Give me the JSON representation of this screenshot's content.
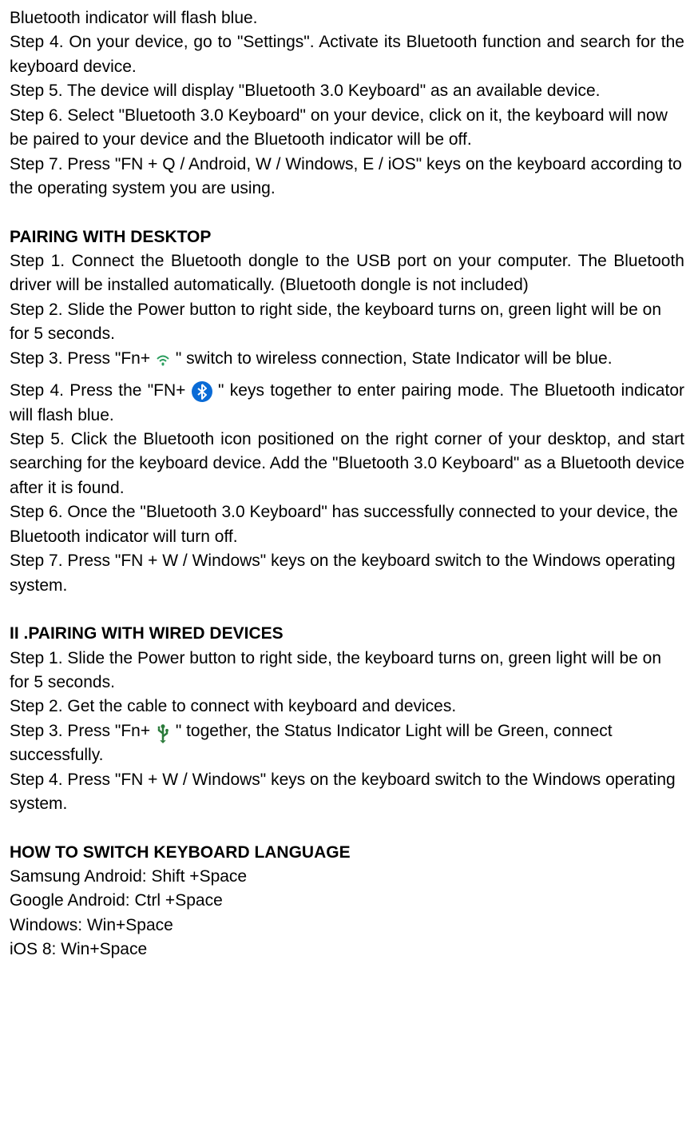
{
  "section1": {
    "line1": "Bluetooth indicator will flash blue.",
    "step4": "Step 4. On your device, go to \"Settings\". Activate its Bluetooth function and search for the keyboard device.",
    "step5": "Step 5. The device will display \"Bluetooth 3.0 Keyboard\" as an available device.",
    "step6": "Step 6. Select \"Bluetooth 3.0 Keyboard\" on your device, click on it, the keyboard will now be paired to your device and the Bluetooth indicator will be off.",
    "step7": "Step 7. Press \"FN + Q / Android, W / Windows, E / iOS\" keys on the keyboard according to the operating system you are using."
  },
  "section2": {
    "heading": "PAIRING WITH DESKTOP",
    "step1": "Step 1. Connect the Bluetooth dongle to the USB port on your computer. The Bluetooth driver will be installed automatically.   (Bluetooth dongle is not included)",
    "step2": "Step 2. Slide the Power button to right side, the keyboard turns on, green light will be on for 5 seconds.",
    "step3_part1": "Step 3. Press \"Fn+",
    "step3_part2": "\" switch to wireless connection, State Indicator will be blue.",
    "step4_part1": "Step 4. Press the \"FN+ ",
    "step4_part2": " \" keys together to enter pairing mode. The Bluetooth indicator will flash blue.",
    "step5": "Step 5. Click the Bluetooth icon positioned on the right corner of your desktop, and start searching for the keyboard device. Add the \"Bluetooth 3.0 Keyboard\" as a Bluetooth device after it is found.",
    "step6": "Step 6. Once the \"Bluetooth 3.0 Keyboard\" has successfully connected to your device, the Bluetooth indicator will turn off.",
    "step7": "Step 7. Press \"FN + W / Windows\" keys on the keyboard switch to the Windows operating system."
  },
  "section3": {
    "heading": "II .PAIRING WITH WIRED DEVICES",
    "step1": "Step 1. Slide the Power button to right side, the keyboard turns on, green light will be on for 5 seconds.",
    "step2": "Step 2. Get the cable to connect with keyboard and devices.",
    "step3_part1": "Step 3. Press \"Fn+",
    "step3_part2": "\" together, the Status Indicator Light will be Green, connect successfully.",
    "step4": "Step 4. Press \"FN + W / Windows\" keys on the keyboard switch to the Windows operating system."
  },
  "section4": {
    "heading": "HOW TO SWITCH KEYBOARD LANGUAGE",
    "line1": "Samsung   Android: Shift +Space",
    "line2": "Google   Android: Ctrl +Space",
    "line3": "Windows: Win+Space",
    "line4": "iOS 8: Win+Space"
  },
  "icons": {
    "wifi": "wifi-icon",
    "bluetooth": "bluetooth-icon",
    "usb": "usb-icon"
  }
}
